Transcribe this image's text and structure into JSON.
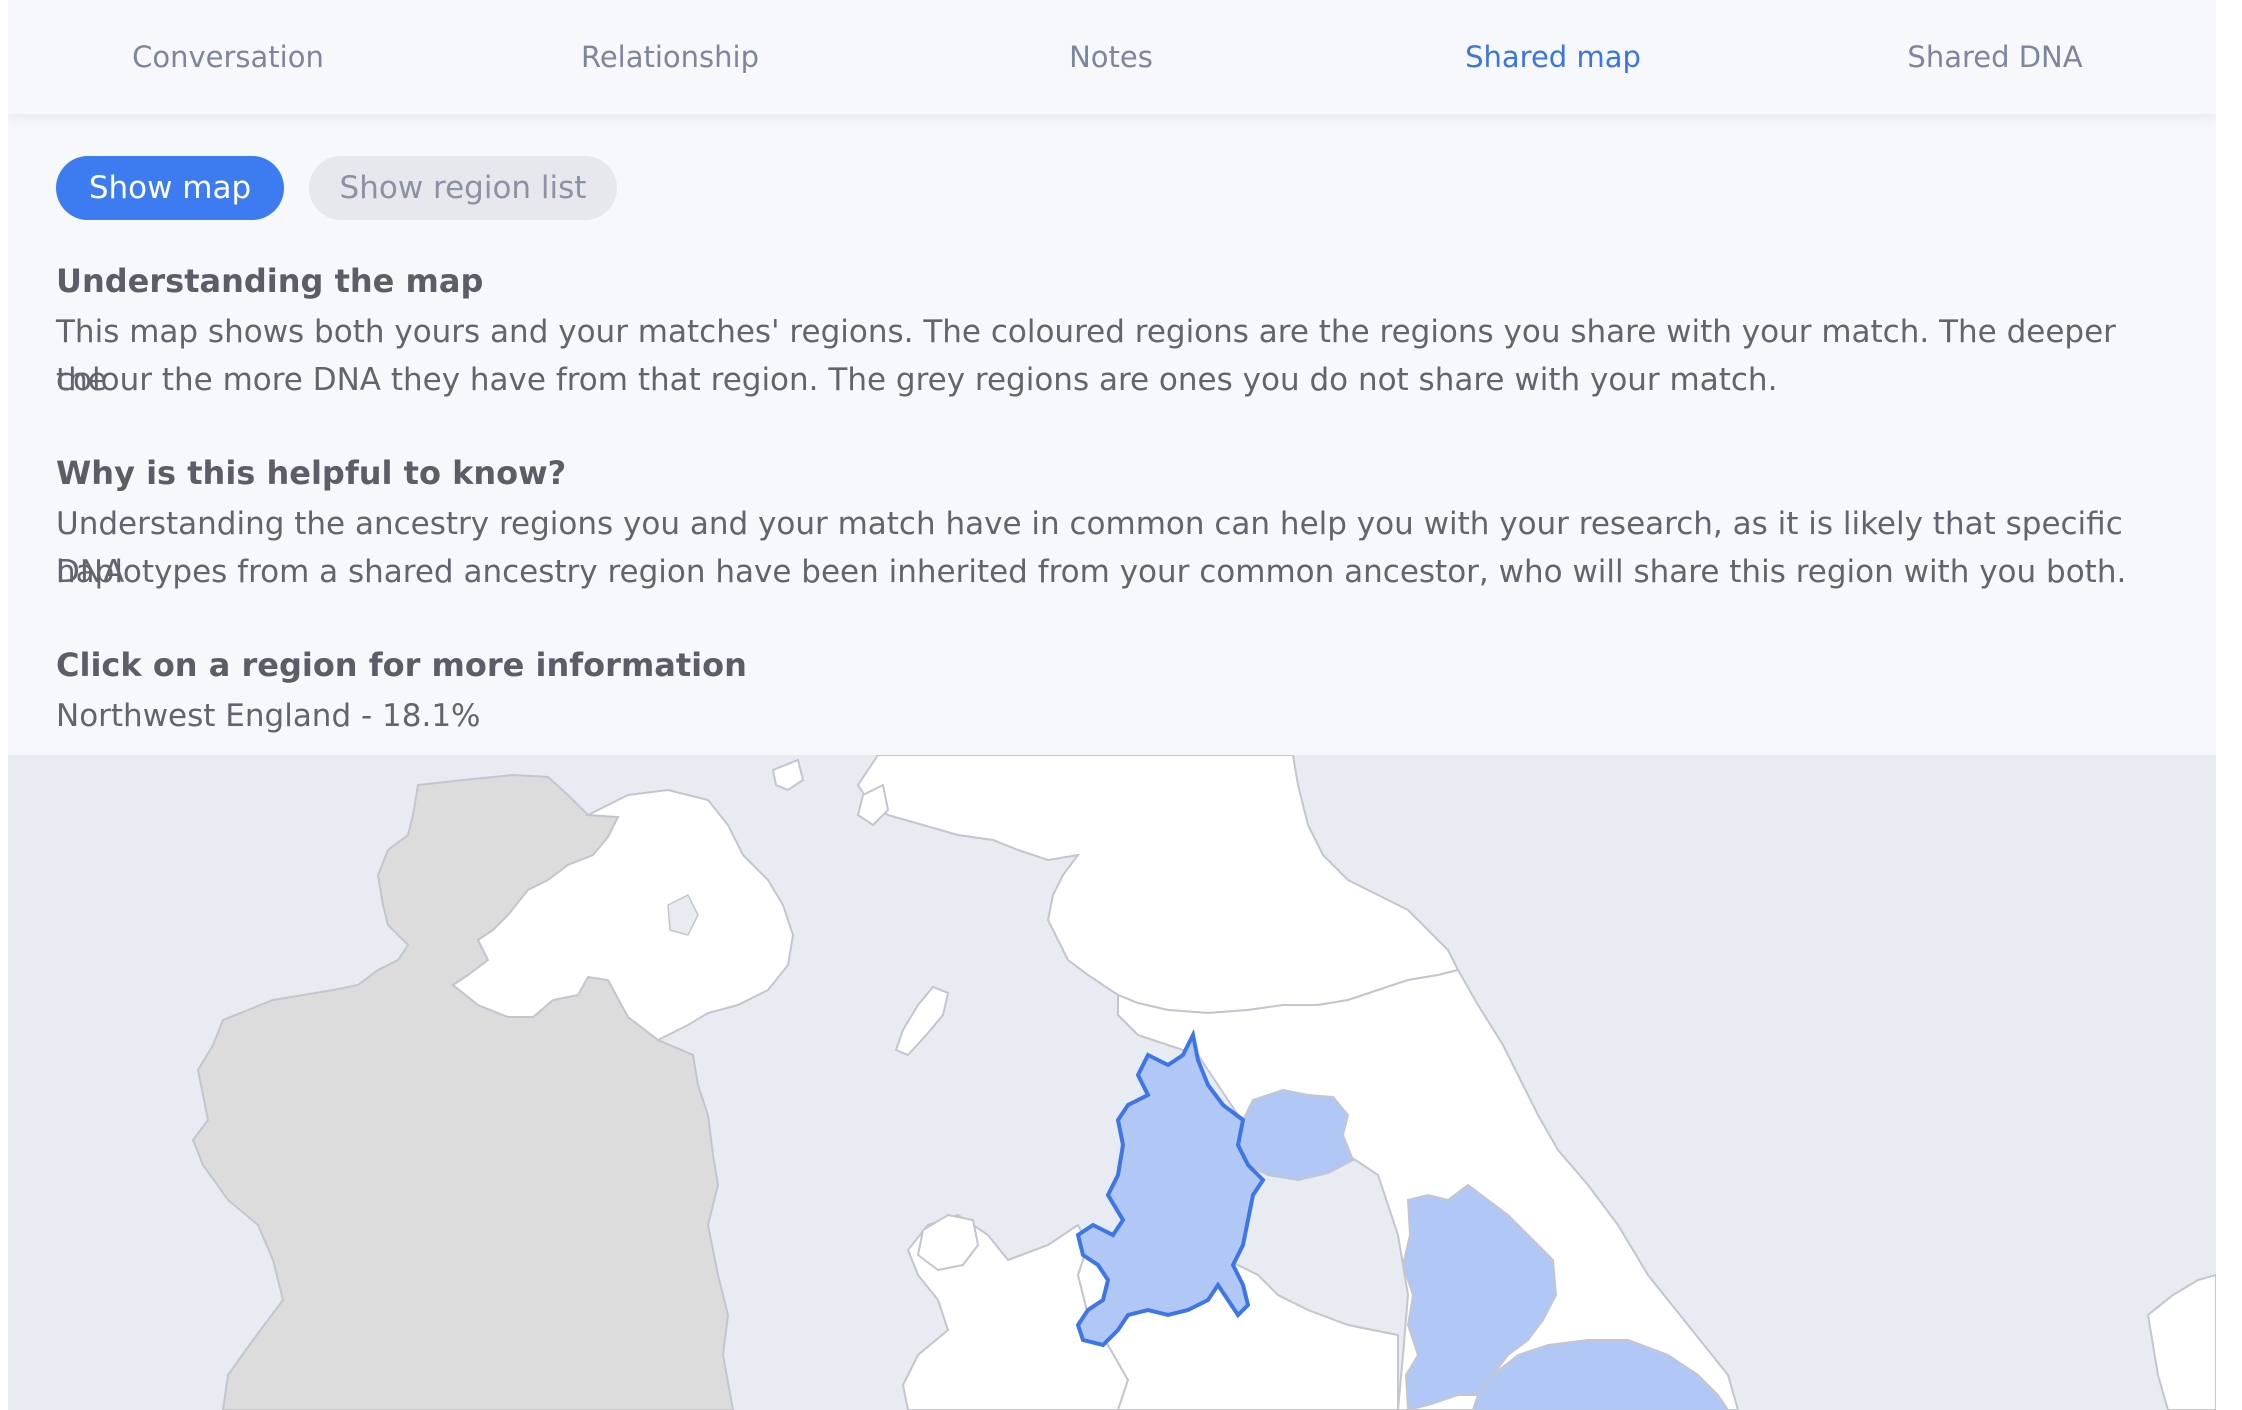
{
  "tabs": [
    {
      "label": "Conversation",
      "active": false
    },
    {
      "label": "Relationship",
      "active": false
    },
    {
      "label": "Notes",
      "active": false
    },
    {
      "label": "Shared map",
      "active": true
    },
    {
      "label": "Shared DNA",
      "active": false
    }
  ],
  "view_toggle": {
    "show_map": "Show map",
    "show_region_list": "Show region list"
  },
  "sections": {
    "understanding_title": "Understanding the map",
    "understanding_line1": "This map shows both yours and your matches' regions. The coloured regions are the regions you share with your match. The deeper the",
    "understanding_line2": "colour the more DNA they have from that region. The grey regions are ones you do not share with your match.",
    "helpful_title": "Why is this helpful to know?",
    "helpful_line1": "Understanding the ancestry regions you and your match have in common can help you with your research, as it is likely that specific DNA",
    "helpful_line2": "haplotypes from a shared ancestry region have been inherited from your common ancestor, who will share this region with you both.",
    "click_title": "Click on a region for more information",
    "selected_region": "Northwest England - 18.1%"
  },
  "colors": {
    "accent": "#3b74e3",
    "shared_region": "#b1c8f7",
    "selected_outline": "#3d76e6",
    "not_shared": "#dcdcdc",
    "land": "#ffffff",
    "sea": "#e8ebf2"
  },
  "map": {
    "selected_region_name": "Northwest England"
  }
}
